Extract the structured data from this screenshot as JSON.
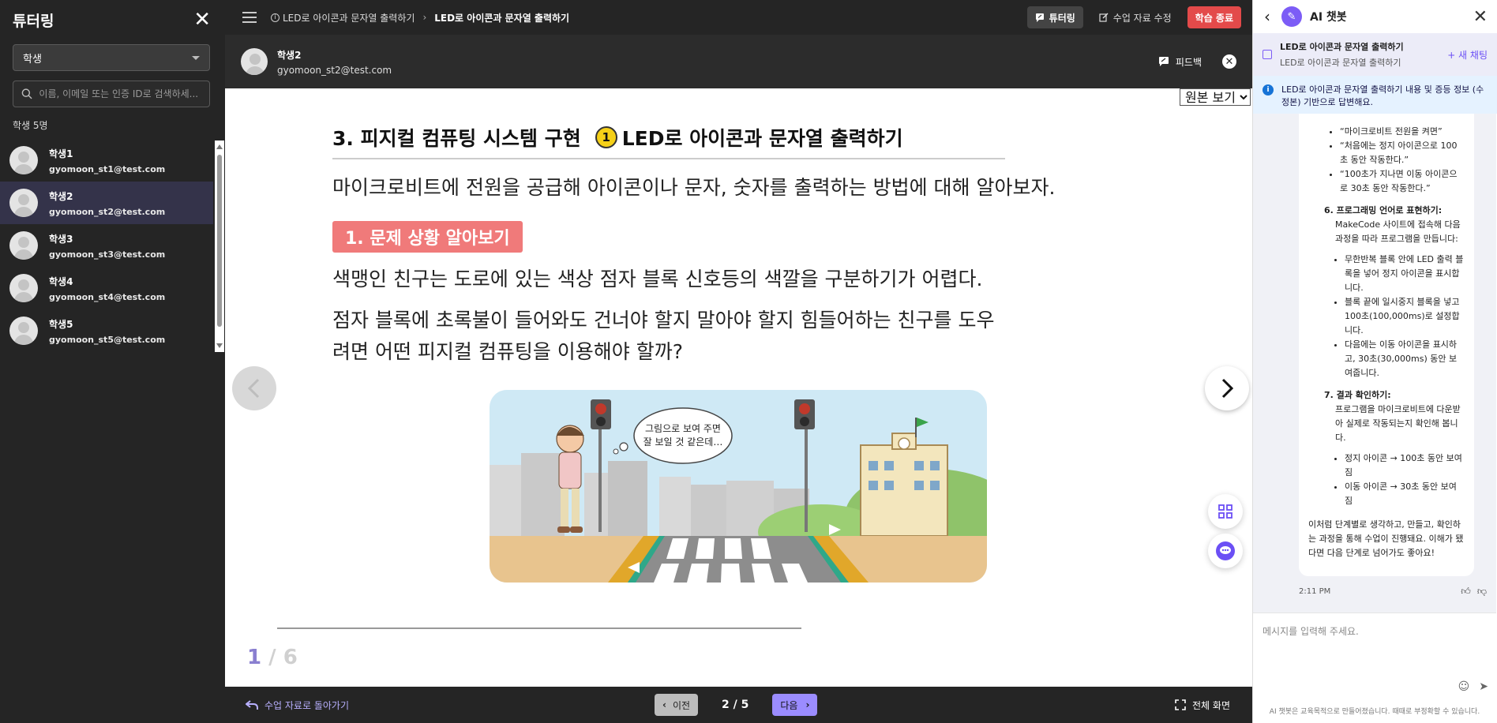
{
  "sidebar": {
    "title": "튜터링",
    "role_select": "학생",
    "search_placeholder": "이름, 이메일 또는 인증 ID로 검색하세...",
    "count_text": "학생 5명",
    "students": [
      {
        "name": "학생1",
        "email": "gyomoon_st1@test.com"
      },
      {
        "name": "학생2",
        "email": "gyomoon_st2@test.com"
      },
      {
        "name": "학생3",
        "email": "gyomoon_st3@test.com"
      },
      {
        "name": "학생4",
        "email": "gyomoon_st4@test.com"
      },
      {
        "name": "학생5",
        "email": "gyomoon_st5@test.com"
      }
    ]
  },
  "topbar": {
    "breadcrumb_parent": "LED로 아이콘과 문자열 출력하기",
    "breadcrumb_current": "LED로 아이콘과 문자열 출력하기",
    "tutoring_label": "튜터링",
    "edit_label": "수업 자료 수정",
    "end_label": "학습 종료"
  },
  "student_header": {
    "name": "학생2",
    "email": "gyomoon_st2@test.com",
    "feedback_label": "피드백"
  },
  "content": {
    "view_select": "원본 보기",
    "title_prefix": "3. 피지컬 컴퓨팅 시스템 구현",
    "title_num": "1",
    "title_suffix": "LED로 아이콘과 문자열 출력하기",
    "intro": "마이크로비트에 전원을 공급해 아이콘이나 문자, 숫자를 출력하는 방법에 대해 알아보자.",
    "section_tag": "1. 문제 상황 알아보기",
    "para1": "색맹인 친구는 도로에 있는 색상 점자 블록 신호등의 색깔을 구분하기가 어렵다.",
    "para2": "점자 블록에 초록불이 들어와도 건너야 할지 말아야 할지 힘들어하는 친구를 도우려면 어떤 피지컬 컴퓨팅을 이용해야 할까?",
    "speech_line1": "그림으로 보여 주면",
    "speech_line2": "잘 보일 것 같은데…",
    "page_current": "1",
    "page_total": "/ 6"
  },
  "bottombar": {
    "back_label": "수업 자료로 돌아가기",
    "prev_label": "이전",
    "page_count": "2 / 5",
    "next_label": "다음",
    "fullscreen_label": "전체 화면"
  },
  "chat": {
    "title": "AI 챗봇",
    "topic_title": "LED로 아이콘과 문자열 출력하기",
    "topic_sub": "LED로 아이콘과 문자열 출력하기",
    "new_chat_label": "+ 새 채팅",
    "notice": "LED로 아이콘과 문자열 출력하기 내용 및 증등 정보 (수정본) 기반으로 답변해요.",
    "top_bullets": [
      "“마이크로비트 전원을 켜면”",
      "“처음에는 정지 아이콘으로 100초 동안 작동한다.”",
      "“100초가 지나면 이동 아이콘으로 30초 동안 작동한다.”"
    ],
    "step6_title": "6. 프로그래밍 언어로 표현하기:",
    "step6_desc": "MakeCode 사이트에 접속해 다음 과정을 따라 프로그램을 만듭니다:",
    "step6_bullets": [
      "무한반복 블록 안에 LED 출력 블록을 넣어 정지 아이콘을 표시합니다.",
      "블록 끝에 일시중지 블록을 넣고 100초(100,000ms)로 설정합니다.",
      "다음에는 이동 아이콘을 표시하고, 30초(30,000ms) 동안 보여줍니다."
    ],
    "step7_title": "7. 결과 확인하기:",
    "step7_desc": "프로그램을 마이크로비트에 다운받아 실제로 작동되는지 확인해 봅니다.",
    "step7_bullets": [
      "정지 아이콘 → 100초 동안 보여짐",
      "이동 아이콘 → 30초 동안 보여짐"
    ],
    "closing": "이처럼 단계별로 생각하고, 만들고, 확인하는 과정을 통해 수업이 진행돼요. 이해가 됐다면 다음 단계로 넘어가도 좋아요!",
    "time": "2:11 PM",
    "input_placeholder": "메시지를 입력해 주세요.",
    "footer": "AI 챗봇은 교육목적으로 만들어졌습니다. 때때로 부정확할 수 있습니다."
  },
  "colors": {
    "sidebar_bg": "#252525",
    "accent_purple": "#9b8cff",
    "end_red": "#e34a4a",
    "section_pink": "#f07a7a",
    "title_badge_yellow": "#f5d018"
  }
}
